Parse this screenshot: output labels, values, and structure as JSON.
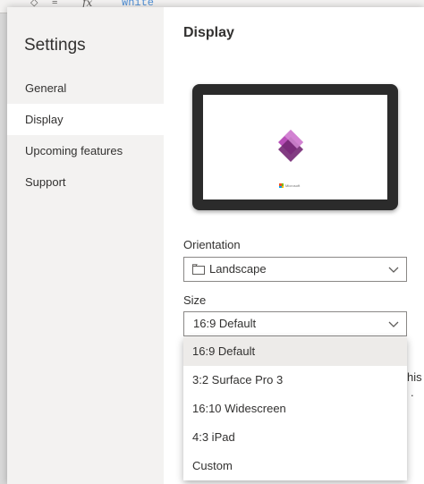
{
  "background_app": {
    "symbols": [
      "◇",
      "≡"
    ],
    "fx_label": "fx",
    "formula": "White"
  },
  "sidebar": {
    "title": "Settings",
    "items": [
      {
        "label": "General"
      },
      {
        "label": "Display"
      },
      {
        "label": "Upcoming features"
      },
      {
        "label": "Support"
      }
    ]
  },
  "main": {
    "title": "Display",
    "clipped_text_top": "",
    "peek_text_right": "his",
    "peek_text_right2": "."
  },
  "preview": {
    "brand_text": "Microsoft"
  },
  "orientation": {
    "label": "Orientation",
    "value": "Landscape"
  },
  "size": {
    "label": "Size",
    "value": "16:9 Default",
    "options": [
      {
        "label": "16:9 Default"
      },
      {
        "label": "3:2 Surface Pro 3"
      },
      {
        "label": "16:10 Widescreen"
      },
      {
        "label": "4:3 iPad"
      },
      {
        "label": "Custom"
      }
    ]
  },
  "colors": {
    "accent": "#742774",
    "sidebar_bg": "#f3f2f1",
    "selected_option_bg": "#edebe9"
  }
}
